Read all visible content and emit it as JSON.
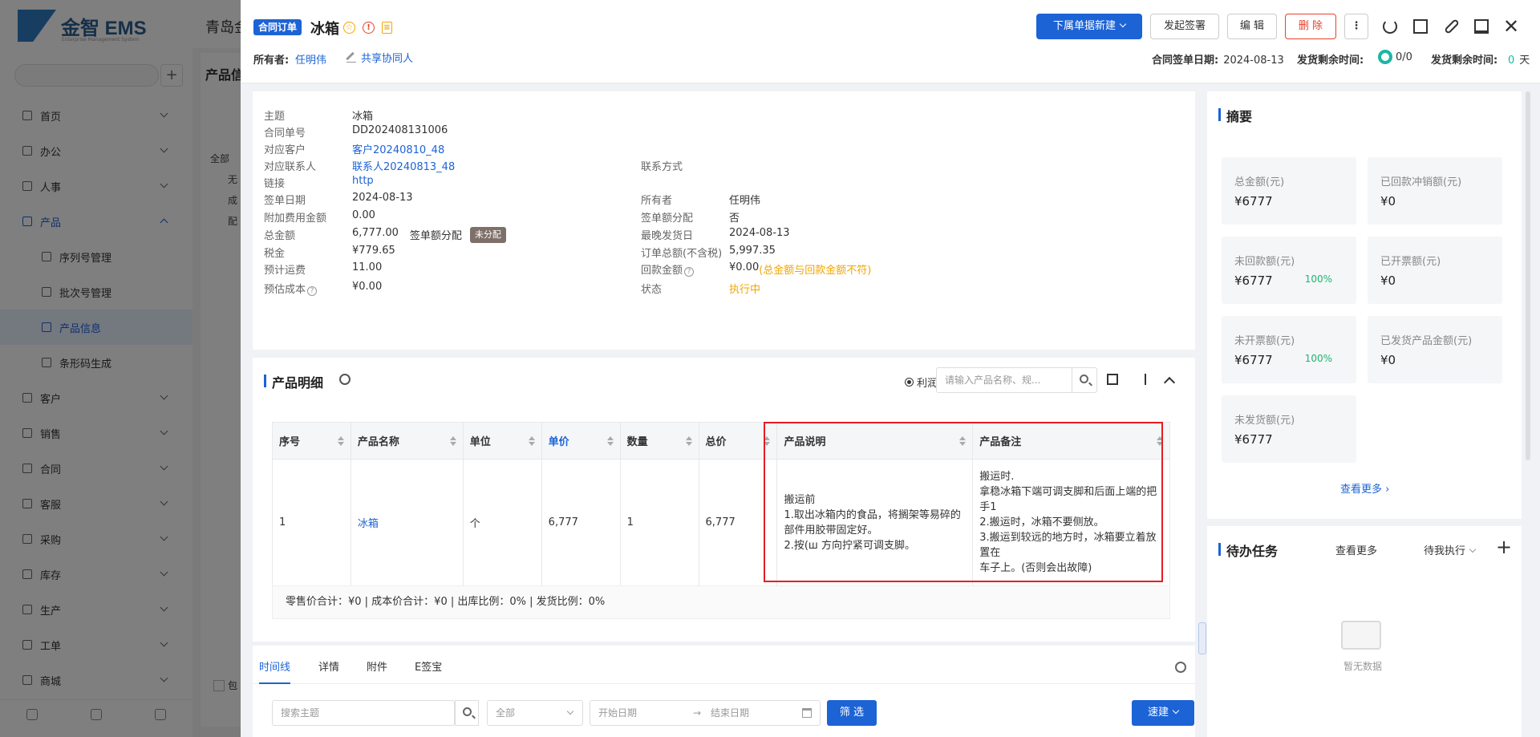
{
  "background": {
    "logo_text": "金智 EMS",
    "logo_sub": "Enterprise Management System",
    "header_title": "青岛金",
    "panel_title": "产品信",
    "search_placeholder": "搜索菜单",
    "menu": [
      {
        "label": "首页",
        "type": "top"
      },
      {
        "label": "办公",
        "type": "top"
      },
      {
        "label": "人事",
        "type": "top"
      },
      {
        "label": "产品",
        "type": "parent"
      },
      {
        "label": "序列号管理",
        "type": "sub"
      },
      {
        "label": "批次号管理",
        "type": "sub"
      },
      {
        "label": "产品信息",
        "type": "active"
      },
      {
        "label": "条形码生成",
        "type": "sub"
      },
      {
        "label": "客户",
        "type": "top"
      },
      {
        "label": "销售",
        "type": "top"
      },
      {
        "label": "合同",
        "type": "top"
      },
      {
        "label": "客服",
        "type": "top"
      },
      {
        "label": "采购",
        "type": "top"
      },
      {
        "label": "库存",
        "type": "top"
      },
      {
        "label": "生产",
        "type": "top"
      },
      {
        "label": "工单",
        "type": "top"
      },
      {
        "label": "商城",
        "type": "top"
      }
    ],
    "tree": [
      "全部",
      "无",
      "成",
      "配"
    ],
    "bottom_check_label": "包"
  },
  "header": {
    "tag": "合同订单",
    "title": "冰箱",
    "owner_label": "所有者:",
    "owner_value": "任明伟",
    "share_label": "共享协同人",
    "buttons": {
      "new": "下属单据新建",
      "sign": "发起签署",
      "edit": "编 辑",
      "delete": "删 除",
      "more": "⋮"
    },
    "sign_date_label": "合同签单日期:",
    "sign_date_value": "2024-08-13",
    "ship_label": "发货剩余时间:",
    "ship_value": "0/0",
    "ship2_label": "发货剩余时间:",
    "ship2_num": "0",
    "ship2_unit": "天"
  },
  "info": {
    "left": [
      {
        "label": "主题",
        "value": "冰箱",
        "kind": "text"
      },
      {
        "label": "合同单号",
        "value": "DD202408131006",
        "kind": "text"
      },
      {
        "label": "对应客户",
        "value": "客户20240810_48",
        "kind": "link"
      },
      {
        "label": "对应联系人",
        "value": "联系人20240813_48",
        "kind": "link"
      },
      {
        "label": "链接",
        "value": "http",
        "kind": "link"
      },
      {
        "label": "签单日期",
        "value": "2024-08-13",
        "kind": "text"
      },
      {
        "label": "附加费用金额",
        "value": "0.00",
        "kind": "text"
      },
      {
        "label": "总金额",
        "value": "6,777.00",
        "kind": "text",
        "extra_label": "签单额分配",
        "badge": "未分配"
      },
      {
        "label": "税金",
        "value": "¥779.65",
        "kind": "text"
      },
      {
        "label": "预计运费",
        "value": "11.00",
        "kind": "text"
      },
      {
        "label": "预估成本",
        "value": "¥0.00",
        "kind": "text",
        "help": "?"
      }
    ],
    "right": [
      {
        "label": "联系方式",
        "value": "",
        "kind": "text"
      },
      {
        "label": "所有者",
        "value": "任明伟",
        "kind": "text"
      },
      {
        "label": "签单额分配",
        "value": "否",
        "kind": "text"
      },
      {
        "label": "最晚发货日",
        "value": "2024-08-13",
        "kind": "text"
      },
      {
        "label": "订单总额(不含税)",
        "value": "5,997.35",
        "kind": "text"
      },
      {
        "label": "回款金额",
        "value": "¥0.00",
        "kind": "text",
        "help": "?",
        "note": "(总金额与回款金额不符)"
      },
      {
        "label": "状态",
        "value": "执行中",
        "kind": "orange"
      }
    ]
  },
  "summary": {
    "title": "摘要",
    "tiles": [
      {
        "label": "总金额(元)",
        "value": "¥6777",
        "pct": ""
      },
      {
        "label": "已回款冲销额(元)",
        "value": "¥0",
        "pct": ""
      },
      {
        "label": "未回款额(元)",
        "value": "¥6777",
        "pct": "100%"
      },
      {
        "label": "已开票额(元)",
        "value": "¥0",
        "pct": ""
      },
      {
        "label": "未开票额(元)",
        "value": "¥6777",
        "pct": "100%"
      },
      {
        "label": "已发货产品金额(元)",
        "value": "¥0",
        "pct": ""
      },
      {
        "label": "未发货额(元)",
        "value": "¥6777",
        "pct": ""
      }
    ],
    "see_more": "查看更多"
  },
  "tasks": {
    "title": "待办任务",
    "see_more": "查看更多",
    "filter": "待我执行",
    "plus": "+",
    "empty": "暂无数据"
  },
  "products": {
    "title": "产品明细",
    "radio_label": "利润",
    "search_placeholder": "请输入产品名称、规...",
    "columns": [
      "序号",
      "产品名称",
      "单位",
      "单价",
      "数量",
      "总价",
      "产品说明",
      "产品备注"
    ],
    "rows": [
      {
        "no": "1",
        "name": "冰箱",
        "unit": "个",
        "price": "6,777",
        "qty": "1",
        "total": "6,777",
        "desc": [
          "搬运前",
          "1.取出冰箱内的食品，将搁架等易碎的部件用胶带固定好。",
          "2.按(ш 方向拧紧可调支脚。"
        ],
        "remark": [
          "搬运时.",
          "拿稳冰箱下端可调支脚和后面上端的把手1",
          "2.搬运时，冰箱不要侧放。",
          "3.搬运到较远的地方时，冰箱要立着放置在",
          "车子上。(否则会出故障)"
        ]
      }
    ],
    "totals": "零售价合计：¥0 |    成本价合计：¥0 |    出库比例：0% |    发货比例：0%"
  },
  "bottom": {
    "tabs": [
      "时间线",
      "详情",
      "附件",
      "E签宝"
    ],
    "search_placeholder": "搜索主题",
    "select_value": "全部",
    "start_date": "开始日期",
    "end_date": "结束日期",
    "arrow": "→",
    "filter_button": "筛 选",
    "quick_button": "速建"
  },
  "colors": {
    "primary": "#1c63d6",
    "danger": "#e8412c",
    "orange": "#f2a600",
    "teal": "#1cb6a4",
    "green": "#1cb66e",
    "highlight": "#e51c23"
  }
}
